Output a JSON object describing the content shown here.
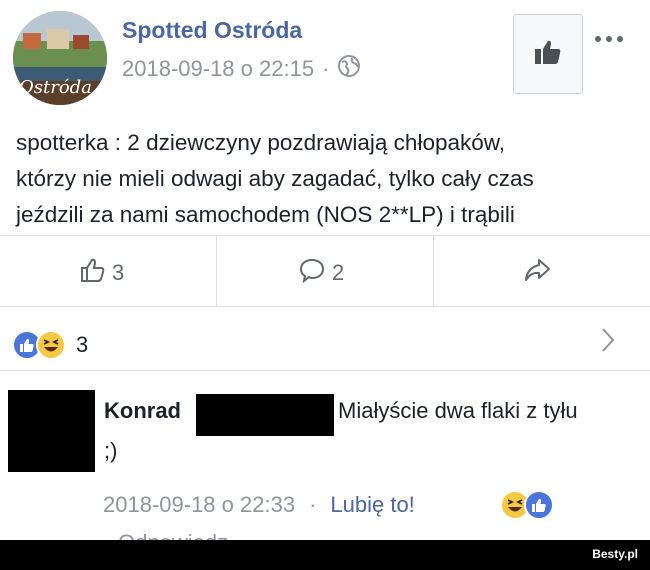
{
  "post": {
    "page_name": "Spotted Ostróda",
    "timestamp": "2018-09-18 o 22:15",
    "separator": "·",
    "avatar_text": "Ostróda",
    "text_lines": [
      "spotterka : 2 dziewczyny pozdrawiają chłopaków,",
      "którzy nie mieli odwagi aby zagadać, tylko cały czas",
      "jeździli za nami samochodem (NOS 2**LP) i trąbili"
    ]
  },
  "actions": {
    "likes": "3",
    "comments": "2"
  },
  "reactions": {
    "count": "3",
    "types": [
      "like-icon",
      "haha-icon"
    ],
    "colors": {
      "like": "#4a76d9",
      "haha": "#f7c844"
    }
  },
  "comment": {
    "author": "Konrad",
    "text": "Miałyście dwa flaki z tyłu",
    "text_cont": ";)",
    "timestamp": "2018-09-18 o 22:33",
    "separator": "·",
    "like_label": "Lubię to!",
    "reply_label": "Odpowiedz"
  },
  "watermark": "Besty.pl",
  "colors": {
    "link": "#4b67a1",
    "meta": "#90949c",
    "divider": "#dadde1"
  }
}
